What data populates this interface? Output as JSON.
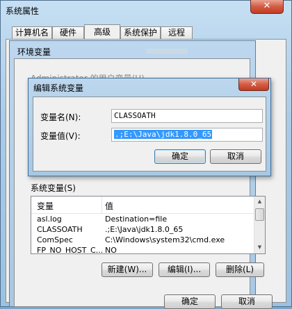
{
  "system_props": {
    "title": "系统属性",
    "close_glyph": "✕",
    "tabs": [
      "计算机名",
      "硬件",
      "高级",
      "系统保护",
      "远程"
    ],
    "ok_label": "确定",
    "cancel_label": "取消"
  },
  "env_vars": {
    "title": "环境变量",
    "user_vars_partial": "Administrator 的用户变量(U)",
    "system_vars_label": "系统变量(S)",
    "columns": [
      "变量",
      "值"
    ],
    "rows": [
      {
        "name": "asl.log",
        "value": "Destination=file"
      },
      {
        "name": "CLASSOATH",
        "value": ".;E:\\Java\\jdk1.8.0_65"
      },
      {
        "name": "ComSpec",
        "value": "C:\\Windows\\system32\\cmd.exe"
      },
      {
        "name": "FP_NO_HOST_C...",
        "value": "NO"
      }
    ],
    "new_label": "新建(W)...",
    "edit_label": "编辑(I)...",
    "delete_label": "删除(L)"
  },
  "edit_dialog": {
    "title": "编辑系统变量",
    "close_glyph": "✕",
    "name_label": "变量名(N):",
    "name_value": "CLASSOATH",
    "value_label": "变量值(V):",
    "value_value": ".;E:\\Java\\jdk1.8.0_65",
    "ok_label": "确定",
    "cancel_label": "取消"
  },
  "colors": {
    "selection": "#3399ff",
    "window_frame": "#a9cbe6",
    "close_button": "#c13b22"
  }
}
